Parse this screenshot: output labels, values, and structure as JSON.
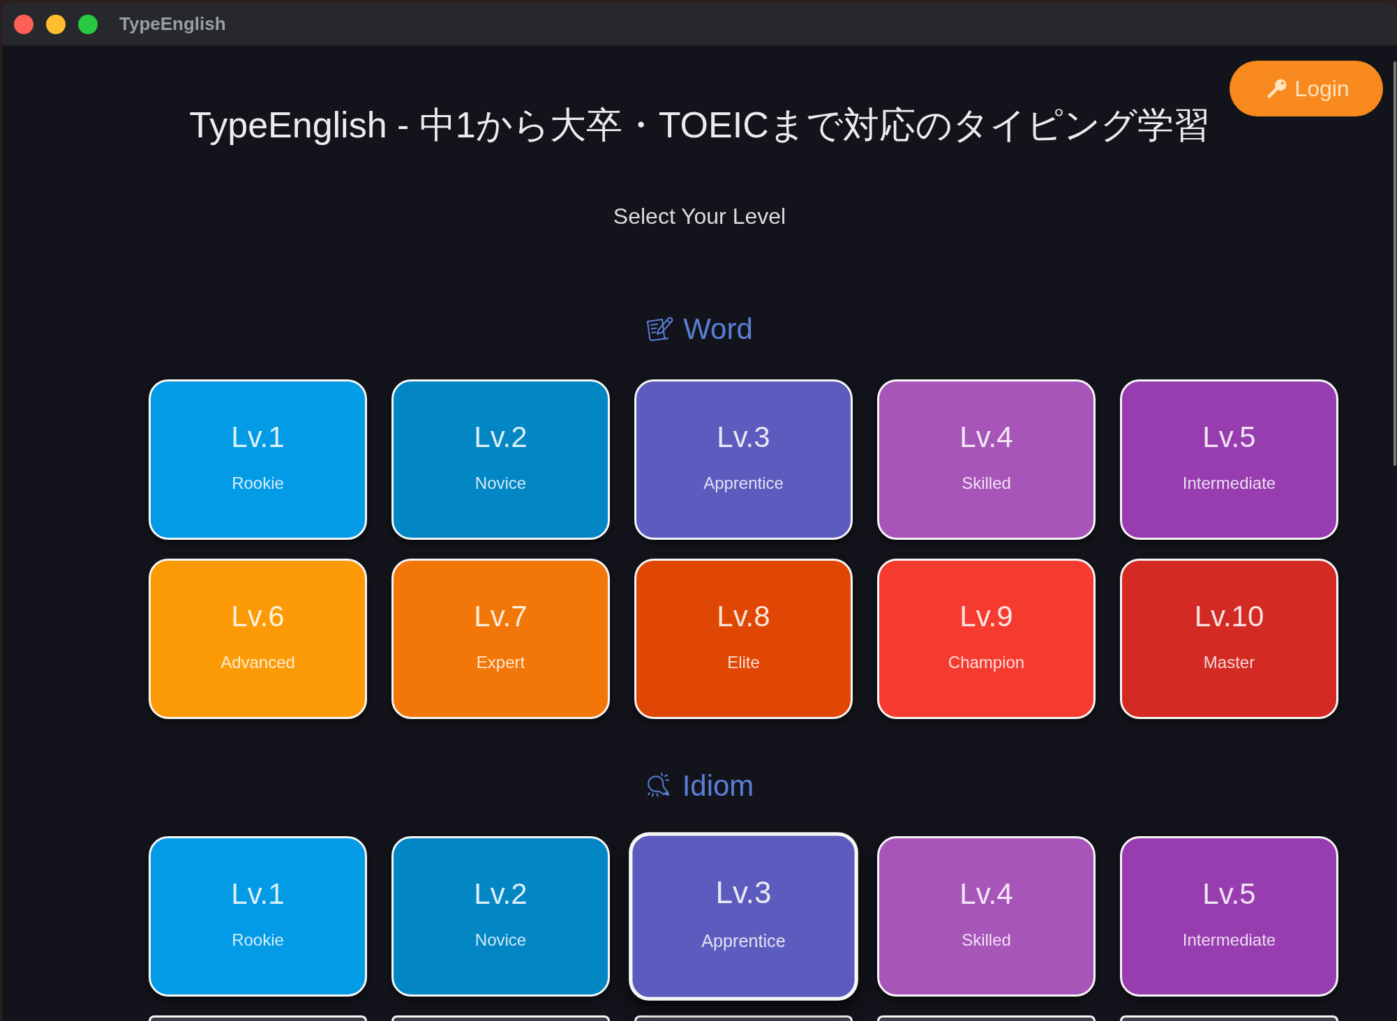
{
  "window": {
    "title": "TypeEnglish"
  },
  "login_button": {
    "label": "Login"
  },
  "page_title": "TypeEnglish - 中1から大卒・TOEICまで対応のタイピング学習",
  "subtitle": "Select Your Level",
  "sections": [
    {
      "kind": "word",
      "heading": "Word",
      "levels": [
        {
          "level": "Lv.1",
          "name": "Rookie",
          "color": "#039be5",
          "selected": false
        },
        {
          "level": "Lv.2",
          "name": "Novice",
          "color": "#0286c4",
          "selected": false
        },
        {
          "level": "Lv.3",
          "name": "Apprentice",
          "color": "#5c5bbe",
          "selected": false
        },
        {
          "level": "Lv.4",
          "name": "Skilled",
          "color": "#a855ba",
          "selected": false
        },
        {
          "level": "Lv.5",
          "name": "Intermediate",
          "color": "#983db0",
          "selected": false
        },
        {
          "level": "Lv.6",
          "name": "Advanced",
          "color": "#fc9a06",
          "selected": false
        },
        {
          "level": "Lv.7",
          "name": "Expert",
          "color": "#f27708",
          "selected": false
        },
        {
          "level": "Lv.8",
          "name": "Elite",
          "color": "#e04705",
          "selected": false
        },
        {
          "level": "Lv.9",
          "name": "Champion",
          "color": "#f53b30",
          "selected": false
        },
        {
          "level": "Lv.10",
          "name": "Master",
          "color": "#d32a24",
          "selected": false
        }
      ]
    },
    {
      "kind": "idiom",
      "heading": "Idiom",
      "levels": [
        {
          "level": "Lv.1",
          "name": "Rookie",
          "color": "#039be5",
          "selected": false
        },
        {
          "level": "Lv.2",
          "name": "Novice",
          "color": "#0286c4",
          "selected": false
        },
        {
          "level": "Lv.3",
          "name": "Apprentice",
          "color": "#5c5bbe",
          "selected": true
        },
        {
          "level": "Lv.4",
          "name": "Skilled",
          "color": "#a855ba",
          "selected": false
        },
        {
          "level": "Lv.5",
          "name": "Intermediate",
          "color": "#983db0",
          "selected": false
        }
      ],
      "cut_off_cards": [
        {
          "color": "#3c3e4a"
        },
        {
          "color": "#3c3e4a"
        },
        {
          "color": "#3c3e4a"
        },
        {
          "color": "#3c3e4a"
        },
        {
          "color": "#3c3e4a"
        }
      ]
    }
  ]
}
